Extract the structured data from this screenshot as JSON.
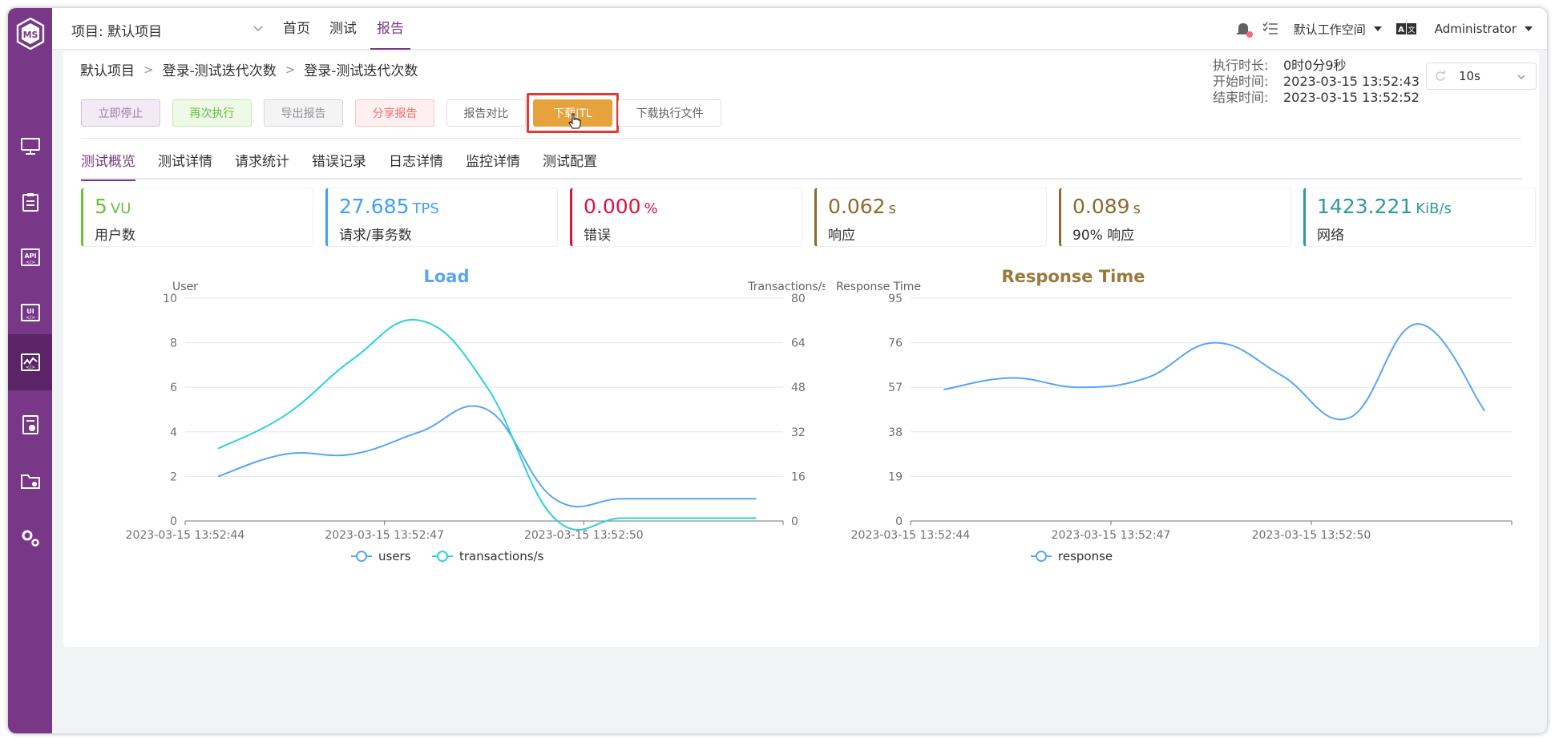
{
  "colors": {
    "sidebar": "#783887",
    "accent": "#783887",
    "users": "#5aa5f5",
    "transactions": "#2fd0dc",
    "load_title": "#5aa5f5",
    "response_title": "#9a7a3c"
  },
  "topbar": {
    "project": "项目: 默认项目",
    "menu": [
      "首页",
      "测试",
      "报告"
    ],
    "workspace": "默认工作空间",
    "user": "Administrator"
  },
  "breadcrumb": [
    "默认项目",
    "登录-测试迭代次数",
    "登录-测试迭代次数"
  ],
  "actions": {
    "stop": "立即停止",
    "rerun": "再次执行",
    "export": "导出报告",
    "share": "分享报告",
    "compare": "报告对比",
    "download_jtl": "下载JTL",
    "download_file": "下载执行文件"
  },
  "exec": {
    "duration_label": "执行时长:",
    "duration": "0时0分9秒",
    "start_label": "开始时间:",
    "start": "2023-03-15 13:52:43",
    "end_label": "结束时间:",
    "end": "2023-03-15 13:52:52",
    "refresh": "10s"
  },
  "tabs": [
    "测试概览",
    "测试详情",
    "请求统计",
    "错误记录",
    "日志详情",
    "监控详情",
    "测试配置"
  ],
  "stats": [
    {
      "value": "5",
      "unit": "VU",
      "label": "用户数",
      "color": "#67c23a"
    },
    {
      "value": "27.685",
      "unit": "TPS",
      "label": "请求/事务数",
      "color": "#409eff"
    },
    {
      "value": "0.000",
      "unit": "%",
      "label": "错误",
      "color": "#e0103c"
    },
    {
      "value": "0.062",
      "unit": "s",
      "label": "响应",
      "color": "#8c6a2e"
    },
    {
      "value": "0.089",
      "unit": "s",
      "label": "90% 响应",
      "color": "#8c6a2e"
    },
    {
      "value": "1423.221",
      "unit": "KiB/s",
      "label": "网络",
      "color": "#2d9a9a"
    }
  ],
  "chart_data": [
    {
      "type": "line",
      "title": "Load",
      "ylabel": "User",
      "y2label": "Transactions/s",
      "ylim": [
        0,
        10
      ],
      "y2lim": [
        0,
        80
      ],
      "yticks": [
        "0",
        "2",
        "4",
        "6",
        "8",
        "10"
      ],
      "y2ticks": [
        "0",
        "16",
        "32",
        "48",
        "64",
        "80"
      ],
      "xticks": [
        "2023-03-15 13:52:44",
        "2023-03-15 13:52:47",
        "2023-03-15 13:52:50"
      ],
      "grid": true,
      "legend": "bottom",
      "x": [
        0,
        1,
        2,
        3,
        4,
        5,
        6,
        7,
        8
      ],
      "series": [
        {
          "name": "users",
          "axis": "left",
          "values": [
            2,
            3,
            3,
            4,
            5,
            1,
            1,
            1,
            1
          ]
        },
        {
          "name": "transactions/s",
          "axis": "right",
          "values": [
            26,
            38,
            58,
            72,
            48,
            1,
            1,
            1,
            1
          ]
        }
      ]
    },
    {
      "type": "line",
      "title": "Response Time",
      "ylabel": "Response Time",
      "ylim": [
        0,
        95
      ],
      "yticks": [
        "0",
        "19",
        "38",
        "57",
        "76",
        "95"
      ],
      "xticks": [
        "2023-03-15 13:52:44",
        "2023-03-15 13:52:47",
        "2023-03-15 13:52:50"
      ],
      "grid": true,
      "legend": "bottom",
      "x": [
        0,
        1,
        2,
        3,
        4,
        5,
        6,
        7,
        8
      ],
      "series": [
        {
          "name": "response",
          "values": [
            56,
            61,
            57,
            61,
            76,
            62,
            44,
            84,
            47
          ]
        }
      ]
    }
  ]
}
